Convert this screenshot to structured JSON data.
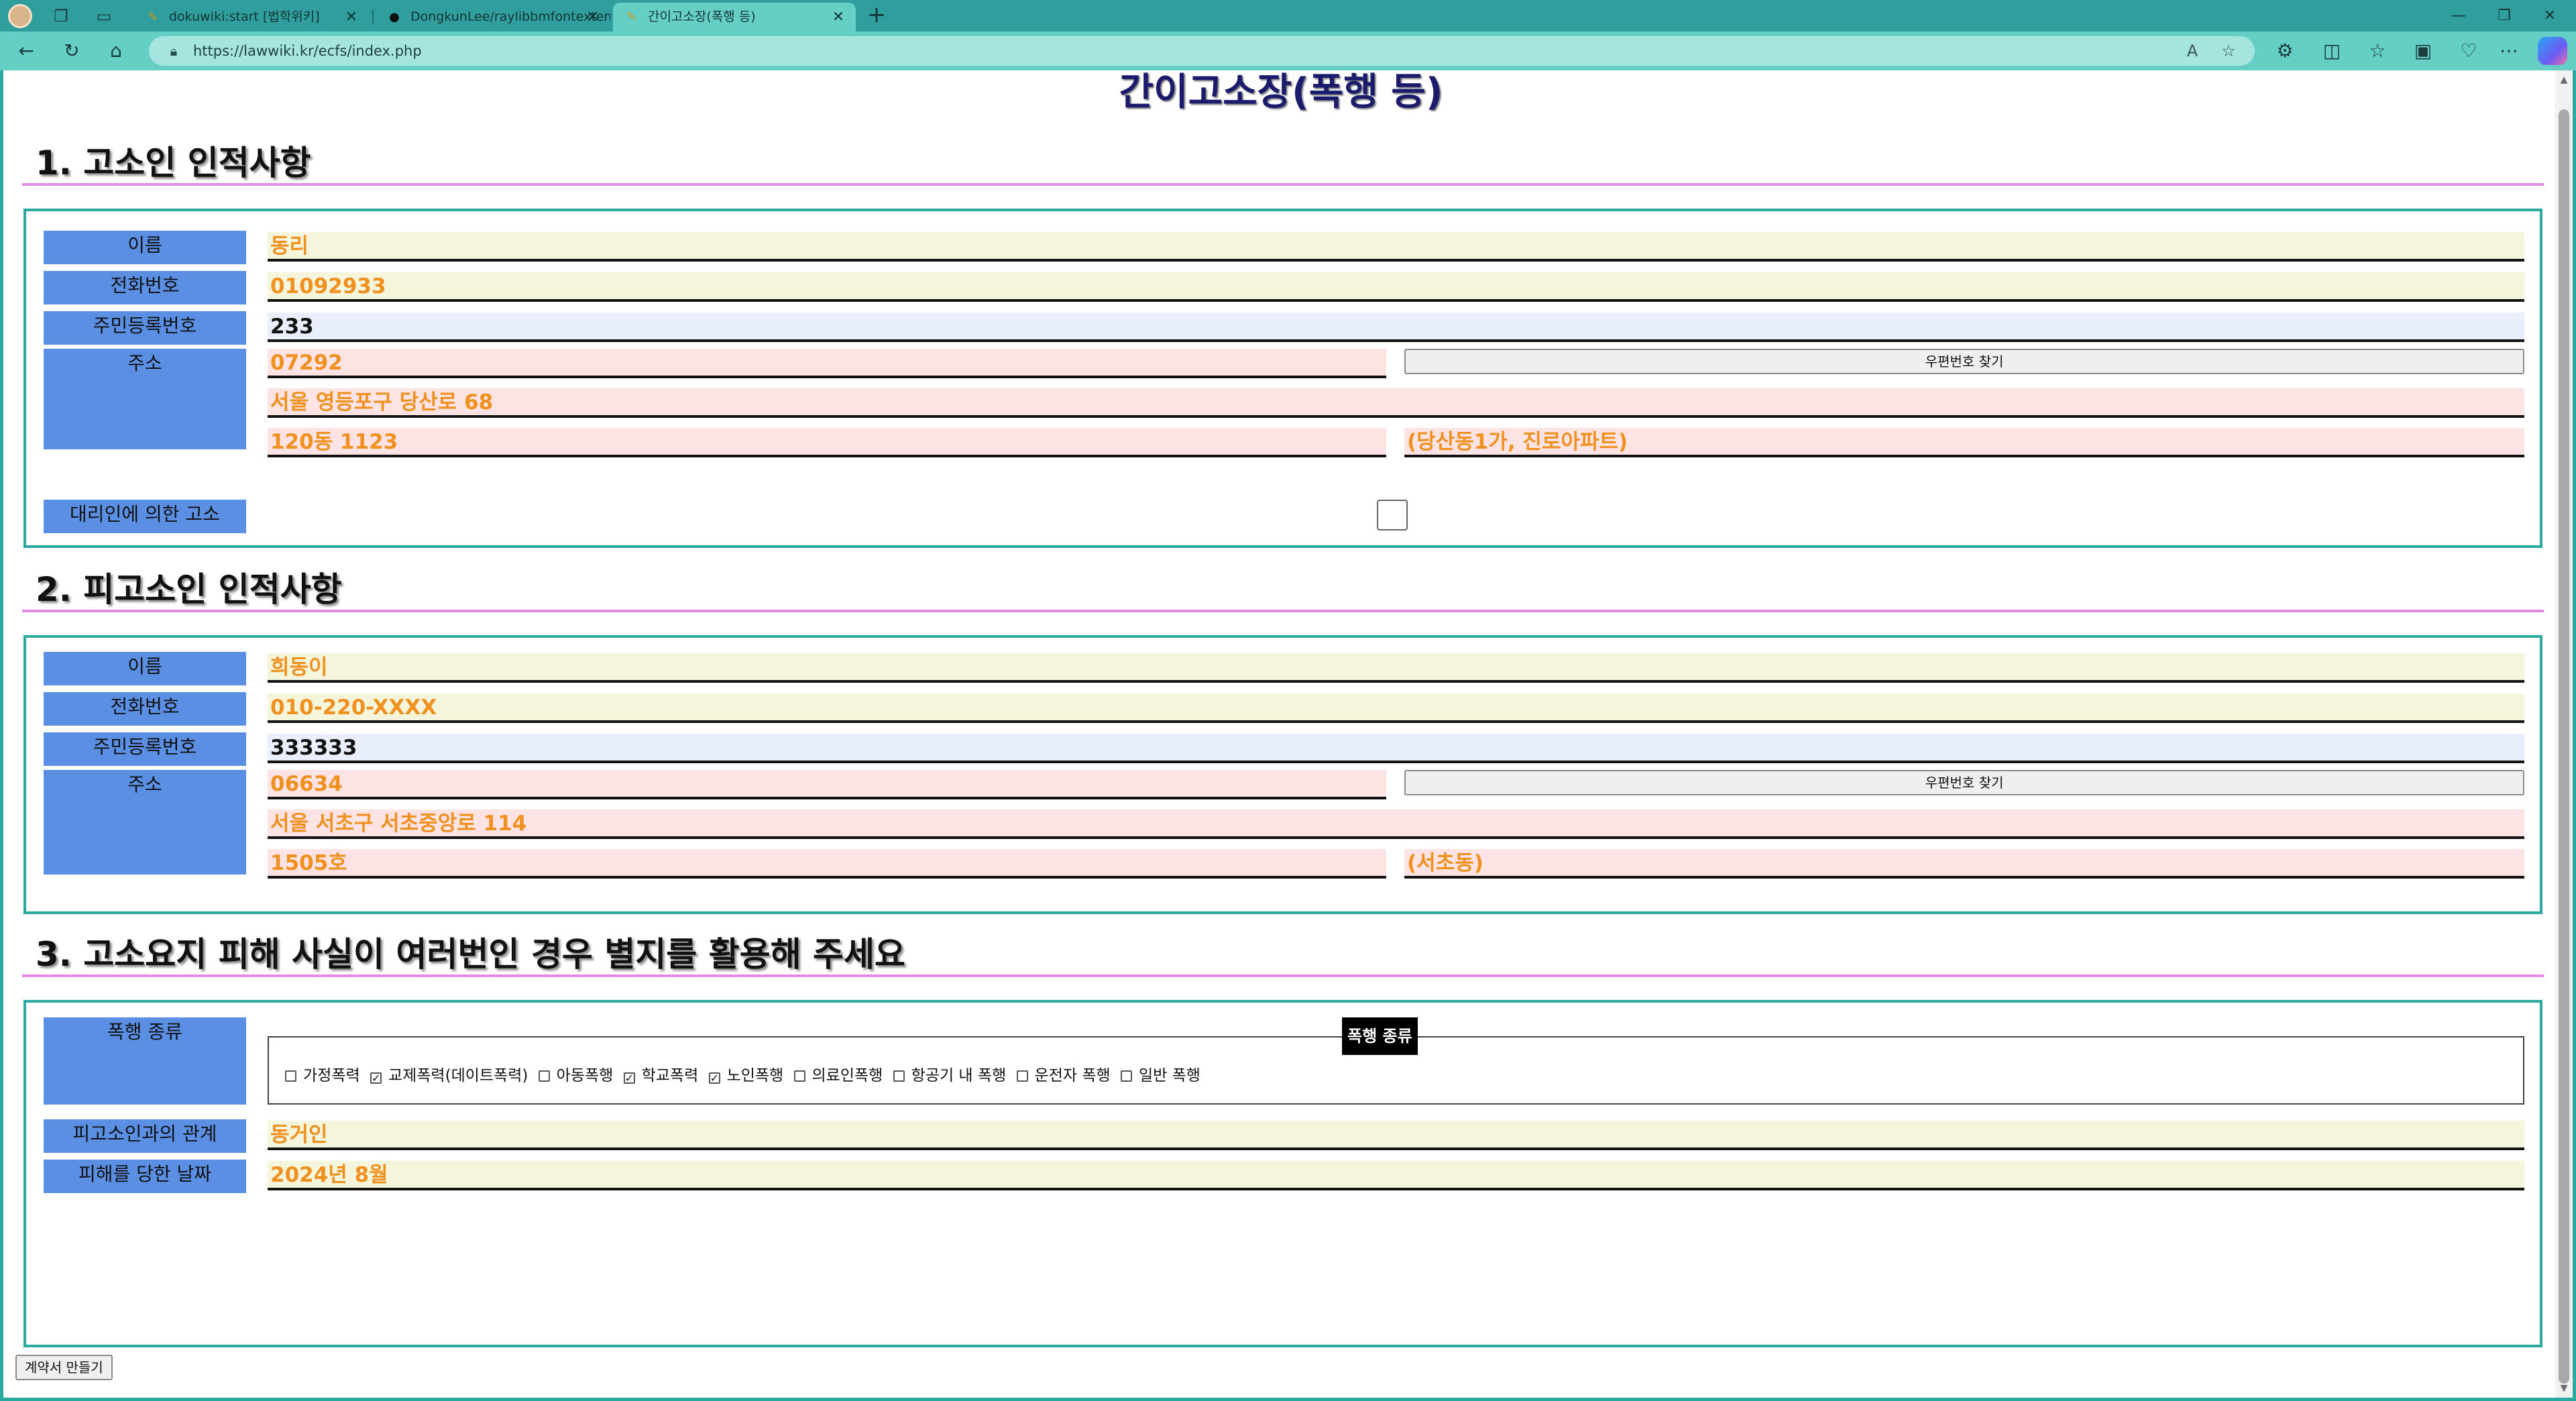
{
  "browser": {
    "tabs": [
      {
        "label": "dokuwiki:start [법학위키]"
      },
      {
        "label": "DongkunLee/raylibbmfontexten"
      },
      {
        "label": "간이고소장(폭행 등)"
      }
    ],
    "url": "https://lawwiki.kr/ecfs/index.php"
  },
  "page": {
    "title": "간이고소장(폭행 등)",
    "section1": {
      "heading": "1. 고소인 인적사항",
      "labels": {
        "name": "이름",
        "phone": "전화번호",
        "rrn": "주민등록번호",
        "address": "주소",
        "proxy": "대리인에 의한 고소"
      },
      "values": {
        "name": "동리",
        "phone": "01092933",
        "rrn": "233",
        "zip": "07292",
        "addr1": "서울 영등포구 당산로 68",
        "addr2": "120동 1123",
        "addr_extra": "(당산동1가, 진로아파트)"
      },
      "zip_button": "우편번호 찾기",
      "proxy_checked": false
    },
    "section2": {
      "heading": "2. 피고소인 인적사항",
      "labels": {
        "name": "이름",
        "phone": "전화번호",
        "rrn": "주민등록번호",
        "address": "주소"
      },
      "values": {
        "name": "희동이",
        "phone": "010-220-XXXX",
        "rrn": "333333",
        "zip": "06634",
        "addr1": "서울 서초구 서초중앙로 114",
        "addr2": "1505호",
        "addr_extra": "(서초동)"
      },
      "zip_button": "우편번호 찾기"
    },
    "section3": {
      "heading": "3. 고소요지 피해 사실이 여러번인 경우 별지를 활용해 주세요",
      "labels": {
        "violence_type": "폭행 종류",
        "relation": "피고소인과의 관계",
        "date": "피해를 당한 날짜"
      },
      "legend": "폭행 종류",
      "violence_types": [
        {
          "label": "가정폭력",
          "checked": false
        },
        {
          "label": "교제폭력(데이트폭력)",
          "checked": true
        },
        {
          "label": "아동폭행",
          "checked": false
        },
        {
          "label": "학교폭력",
          "checked": true
        },
        {
          "label": "노인폭행",
          "checked": true
        },
        {
          "label": "의료인폭행",
          "checked": false
        },
        {
          "label": "항공기 내 폭행",
          "checked": false
        },
        {
          "label": "운전자 폭행",
          "checked": false
        },
        {
          "label": "일반 폭행",
          "checked": false
        }
      ],
      "values": {
        "relation": "동거인",
        "date": "2024년 8월"
      }
    },
    "make_button": "계약서 만들기"
  }
}
